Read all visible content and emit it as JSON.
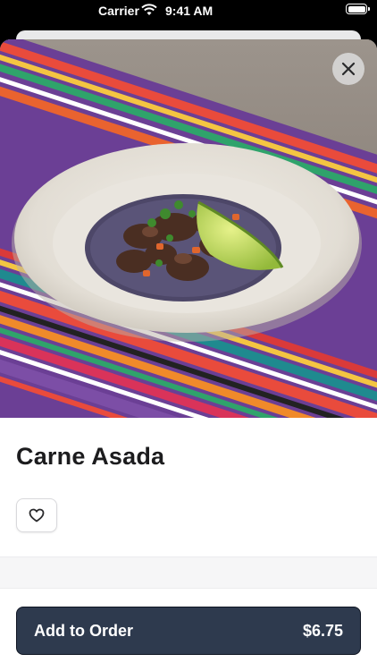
{
  "status_bar": {
    "carrier": "Carrier",
    "time": "9:41 AM"
  },
  "item": {
    "title": "Carne Asada",
    "hero_image_alt": "",
    "favorite_icon": "heart-icon"
  },
  "actions": {
    "add_label": "Add to Order",
    "price": "$6.75",
    "close_icon": "close-icon"
  },
  "colors": {
    "button_bg": "#2e3a4e",
    "button_text": "#ffffff",
    "title_text": "#1c1c1e"
  }
}
